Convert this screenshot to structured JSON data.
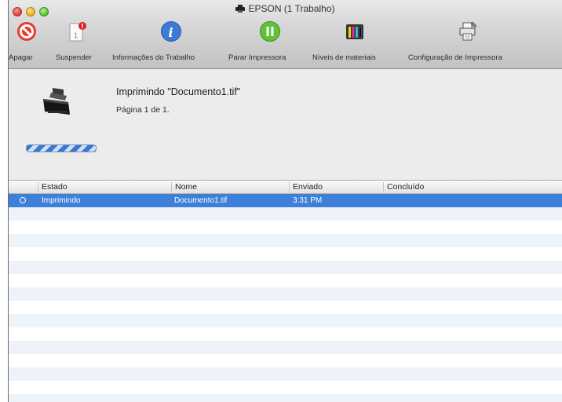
{
  "window": {
    "title": "EPSON (1 Trabalho)"
  },
  "toolbar": {
    "delete_label": "Apagar",
    "hold_label": "Suspender",
    "info_label": "Informações do Trabalho",
    "pause_label": "Parar Impressora",
    "supply_label": "Níveis de materiais",
    "settings_label": "Configuração de Impressora"
  },
  "current_job": {
    "title": "Imprimindo \"Documento1.tif\"",
    "page": "Página 1 de 1."
  },
  "table": {
    "headers": {
      "status": "Estado",
      "name": "Nome",
      "sent": "Enviado",
      "done": "Concluído"
    },
    "rows": [
      {
        "status": "Imprimindo",
        "name": "Documento1.tif",
        "sent": "3:31 PM",
        "done": ""
      }
    ]
  }
}
